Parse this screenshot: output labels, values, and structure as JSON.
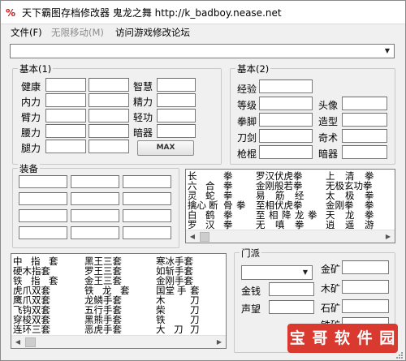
{
  "window": {
    "title": "天下霸图存档修改器 鬼龙之舞 http://k_badboy.nease.net"
  },
  "menu": [
    {
      "label": "文件(F)",
      "disabled": false
    },
    {
      "label": "无限移动(M)",
      "disabled": true
    },
    {
      "label": "访问游戏修改论坛",
      "disabled": false
    }
  ],
  "top_combo": {
    "value": ""
  },
  "basic1": {
    "title": "基本(1)",
    "left_labels": [
      "健康",
      "内力",
      "臂力",
      "腰力",
      "腿力"
    ],
    "right_labels": [
      "智慧",
      "精力",
      "轻功",
      "暗器"
    ],
    "max_button": "MAX"
  },
  "basic2": {
    "title": "基本(2)",
    "left_labels": [
      "经验",
      "等级",
      "拳脚",
      "刀剑",
      "枪棍"
    ],
    "right_labels": [
      "头像",
      "造型",
      "奇术",
      "暗器"
    ]
  },
  "equip": {
    "title": "装备"
  },
  "skills_list": {
    "rows": [
      [
        "长",
        "拳",
        "罗汉伏虎拳",
        "上",
        "清",
        "拳"
      ],
      [
        "六",
        "合",
        "拳",
        "金刚般若拳",
        "无极玄功拳"
      ],
      [
        "灵",
        "蛇",
        "拳",
        "易",
        "筋",
        "经",
        "太",
        "极",
        "拳"
      ],
      [
        "擒心",
        "断",
        "骨",
        "拳",
        "至相伏虎拳",
        "金刚拳",
        "拳"
      ],
      [
        "白",
        "鹤",
        "拳",
        "至",
        "相",
        "降",
        "龙",
        "拳",
        "天",
        "龙",
        "拳"
      ],
      [
        "罗",
        "汉",
        "拳",
        "无",
        "嗔",
        "拳",
        "逍",
        "遥",
        "游"
      ]
    ]
  },
  "weapons_list": {
    "rows": [
      [
        "中",
        "指",
        "套",
        "黑王三套",
        "寒冰手套"
      ],
      [
        "硬木指套",
        "罗王三套",
        "如斩手套"
      ],
      [
        "铁",
        "指",
        "套",
        "金王三套",
        "金刚手套"
      ],
      [
        "虎爪双套",
        "铁",
        "龙",
        "套",
        "国堂",
        "手",
        "套"
      ],
      [
        "鹰爪双套",
        "龙鳞手套",
        "木",
        "刀"
      ],
      [
        "飞钩双套",
        "五行手套",
        "柴",
        "刀"
      ],
      [
        "穿梭双套",
        "黑熊手套",
        "铁",
        "刀"
      ],
      [
        "连环三套",
        "恶虎手套",
        "大",
        "刀",
        "刀"
      ]
    ]
  },
  "sect": {
    "title": "门派",
    "combo_value": "",
    "money_label": "金钱",
    "prestige_label": "声望",
    "ore_labels": [
      "金矿",
      "木矿",
      "石矿",
      "铁矿"
    ]
  },
  "watermark": {
    "text": "宝 哥 软 件 园"
  },
  "colors": {
    "accent": "#d9392f",
    "window_bg": "#f0f0f0",
    "field_border": "#7a7a7a"
  }
}
